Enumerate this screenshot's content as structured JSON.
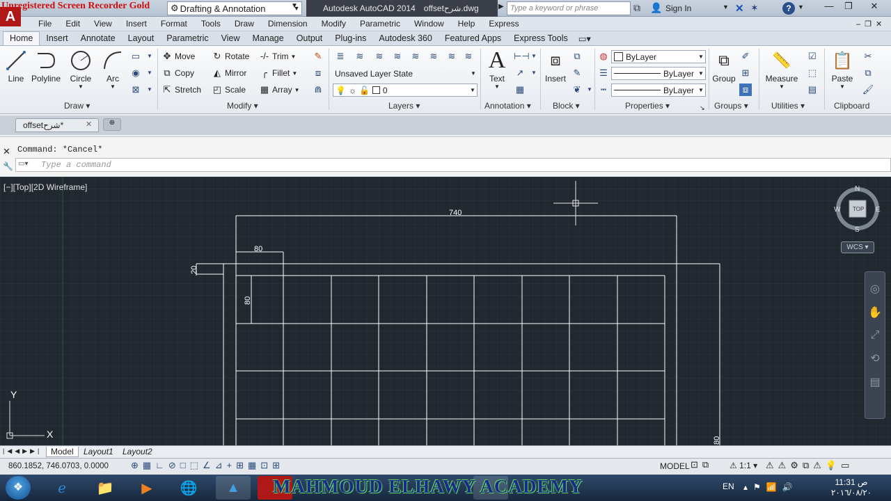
{
  "watermark_top": "Unregistered Screen Recorder Gold",
  "workspace": "Drafting & Annotation",
  "app_title": "Autodesk AutoCAD 2014",
  "file_title": "offsetشرح.dwg",
  "search_placeholder": "Type a keyword or phrase",
  "sign_in": "Sign In",
  "help": "?",
  "menu": [
    "File",
    "Edit",
    "View",
    "Insert",
    "Format",
    "Tools",
    "Draw",
    "Dimension",
    "Modify",
    "Parametric",
    "Window",
    "Help",
    "Express"
  ],
  "ribbon_tabs": [
    "Home",
    "Insert",
    "Annotate",
    "Layout",
    "Parametric",
    "View",
    "Manage",
    "Output",
    "Plug-ins",
    "Autodesk 360",
    "Featured Apps",
    "Express Tools"
  ],
  "draw": {
    "line": "Line",
    "polyline": "Polyline",
    "circle": "Circle",
    "arc": "Arc",
    "panel": "Draw"
  },
  "modify": {
    "move": "Move",
    "rotate": "Rotate",
    "trim": "Trim",
    "copy": "Copy",
    "mirror": "Mirror",
    "fillet": "Fillet",
    "stretch": "Stretch",
    "scale": "Scale",
    "array": "Array",
    "panel": "Modify"
  },
  "layers": {
    "state": "Unsaved Layer State",
    "current": "0",
    "panel": "Layers"
  },
  "annotation": {
    "text": "Text",
    "panel": "Annotation"
  },
  "block": {
    "insert": "Insert",
    "panel": "Block"
  },
  "properties": {
    "color": "ByLayer",
    "lineweight": "ByLayer",
    "linetype": "ByLayer",
    "panel": "Properties"
  },
  "groups": {
    "group": "Group",
    "panel": "Groups"
  },
  "utilities": {
    "measure": "Measure",
    "panel": "Utilities"
  },
  "clipboard": {
    "paste": "Paste",
    "panel": "Clipboard"
  },
  "doc_tab": "offsetشرح*",
  "command_history": "Command: *Cancel*",
  "command_placeholder": "Type a command",
  "viewport_label": "[−][Top][2D Wireframe]",
  "compass": {
    "n": "N",
    "s": "S",
    "e": "E",
    "w": "W",
    "top": "TOP"
  },
  "wcs": "WCS",
  "dims": {
    "d740": "740",
    "d80a": "80",
    "d20": "20",
    "d80b": "80",
    "d80c": "80"
  },
  "ucs": {
    "x": "X",
    "y": "Y"
  },
  "layout_tabs": [
    "Model",
    "Layout1",
    "Layout2"
  ],
  "coordinates": "860.1852, 746.0703, 0.0000",
  "status_model": "MODEL",
  "scale": "1:1",
  "watermark_bottom": "MAHMOUD ELHAWY ACADEMY",
  "lang": "EN",
  "clock_time": "11:31 ص",
  "clock_date": "٢٠١٦/٠٨/٢٠",
  "colors": {
    "canvas": "#212830",
    "accent": "#b01818",
    "taskbar": "#16273d"
  }
}
